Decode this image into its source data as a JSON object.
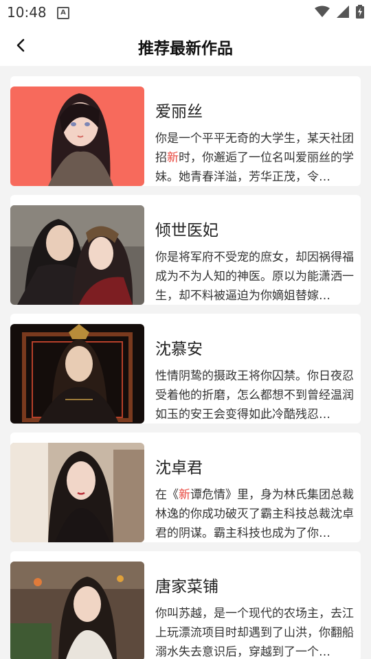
{
  "status_bar": {
    "time": "10:48",
    "notification_icon": "A",
    "icons": [
      "wifi-icon",
      "signal-icon",
      "battery-charging-icon"
    ]
  },
  "header": {
    "title": "推荐最新作品",
    "back_icon": "chevron-left-icon"
  },
  "colors": {
    "highlight": "#e8453c",
    "background": "#f3f3f3",
    "card": "#ffffff"
  },
  "cards": [
    {
      "title": "爱丽丝",
      "desc_before": "你是一个平平无奇的大学生，某天社团招",
      "desc_highlight": "新",
      "desc_after": "时，你邂逅了一位名叫爱丽丝的学妹。她青春洋溢，芳华正茂，令…",
      "image": "portrait of girl with dark hair on coral background"
    },
    {
      "title": "倾世医妃",
      "desc_before": "你是将军府不受宠的庶女，却因祸得福成为不为人知的神医。原以为能潇洒一生，却不料被逼迫为你嫡姐替嫁…",
      "desc_highlight": "",
      "desc_after": "",
      "image": "couple in ancient costume"
    },
    {
      "title": "沈慕安",
      "desc_before": "性情阴鸷的摄政王将你囚禁。你日夜忍受着他的折磨，怎么都想不到曾经温润如玉的安王会变得如此冷酷残忍…",
      "desc_highlight": "",
      "desc_after": "",
      "image": "prince with crown in dark ornate frame"
    },
    {
      "title": "沈卓君",
      "desc_before": "在《",
      "desc_highlight": "新",
      "desc_after": "谭危情》里，身为林氏集团总裁林逸的你成功破灭了霸主科技总裁沈卓君的阴谋。霸主科技也成为了你…",
      "image": "woman in black dress indoors"
    },
    {
      "title": "唐家菜铺",
      "desc_before": "你叫苏越，是一个现代的农场主，去江上玩漂流项目时却遇到了山洪，你翻船溺水失去意识后，穿越到了一个…",
      "desc_highlight": "",
      "desc_after": "",
      "image": "woman in ancient costume at street market"
    }
  ]
}
